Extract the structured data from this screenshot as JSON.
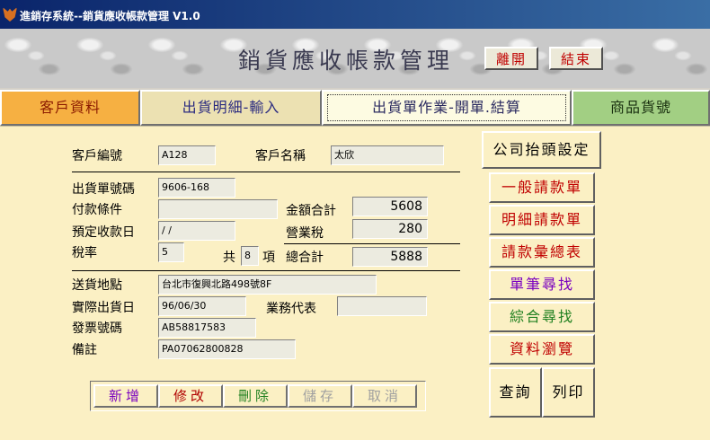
{
  "window": {
    "title": "進銷存系統--銷貨應收帳款管理 V1.0"
  },
  "header": {
    "title": "銷貨應收帳款管理",
    "exit_label": "離開",
    "end_label": "結束"
  },
  "tabs": [
    {
      "label": "客戶資料"
    },
    {
      "label": "出貨明細-輸入"
    },
    {
      "label": "出貨單作業-開單.結算"
    },
    {
      "label": "商品貨號"
    }
  ],
  "form": {
    "customer_id_label": "客戶編號",
    "customer_id": "A128",
    "customer_name_label": "客戶名稱",
    "customer_name": "太欣",
    "order_no_label": "出貨單號碼",
    "order_no": "9606-168",
    "payment_terms_label": "付款條件",
    "payment_terms": "",
    "expected_date_label": "預定收款日",
    "expected_date": "/ /",
    "tax_rate_label": "稅率",
    "tax_rate": "5",
    "amount_total_label": "金額合計",
    "amount_total": "5608",
    "business_tax_label": "營業稅",
    "business_tax": "280",
    "items_prefix": "共",
    "items_count": "8",
    "items_suffix": "項",
    "grand_total_label": "總合計",
    "grand_total": "5888",
    "delivery_address_label": "送貨地點",
    "delivery_address": "台北市復興北路498號8F",
    "ship_date_label": "實際出貨日",
    "ship_date": "96/06/30",
    "sales_rep_label": "業務代表",
    "sales_rep": "",
    "invoice_no_label": "發票號碼",
    "invoice_no": "AB58817583",
    "remarks_label": "備註",
    "remarks": "PA07062800828"
  },
  "actions": {
    "add": "新增",
    "edit": "修改",
    "delete": "刪除",
    "save": "儲存",
    "cancel": "取消"
  },
  "side": {
    "company_header": "公司抬頭設定",
    "general_invoice": "一般請款單",
    "detail_invoice": "明細請款單",
    "invoice_summary": "請款彙總表",
    "single_search": "單筆尋找",
    "combined_search": "綜合尋找",
    "browse": "資料瀏覽",
    "query": "查詢",
    "print": "列印"
  },
  "colors": {
    "tab_customer": "#f6b042",
    "tab_shipment": "#ece1b2",
    "tab_order": "#fdfbe2",
    "tab_product": "#a2cf83",
    "panel_bg": "#fbf0c4",
    "red_text": "#c00000",
    "purple_text": "#7a00c0",
    "green_text": "#208020",
    "disabled_text": "#a0a0a0"
  }
}
